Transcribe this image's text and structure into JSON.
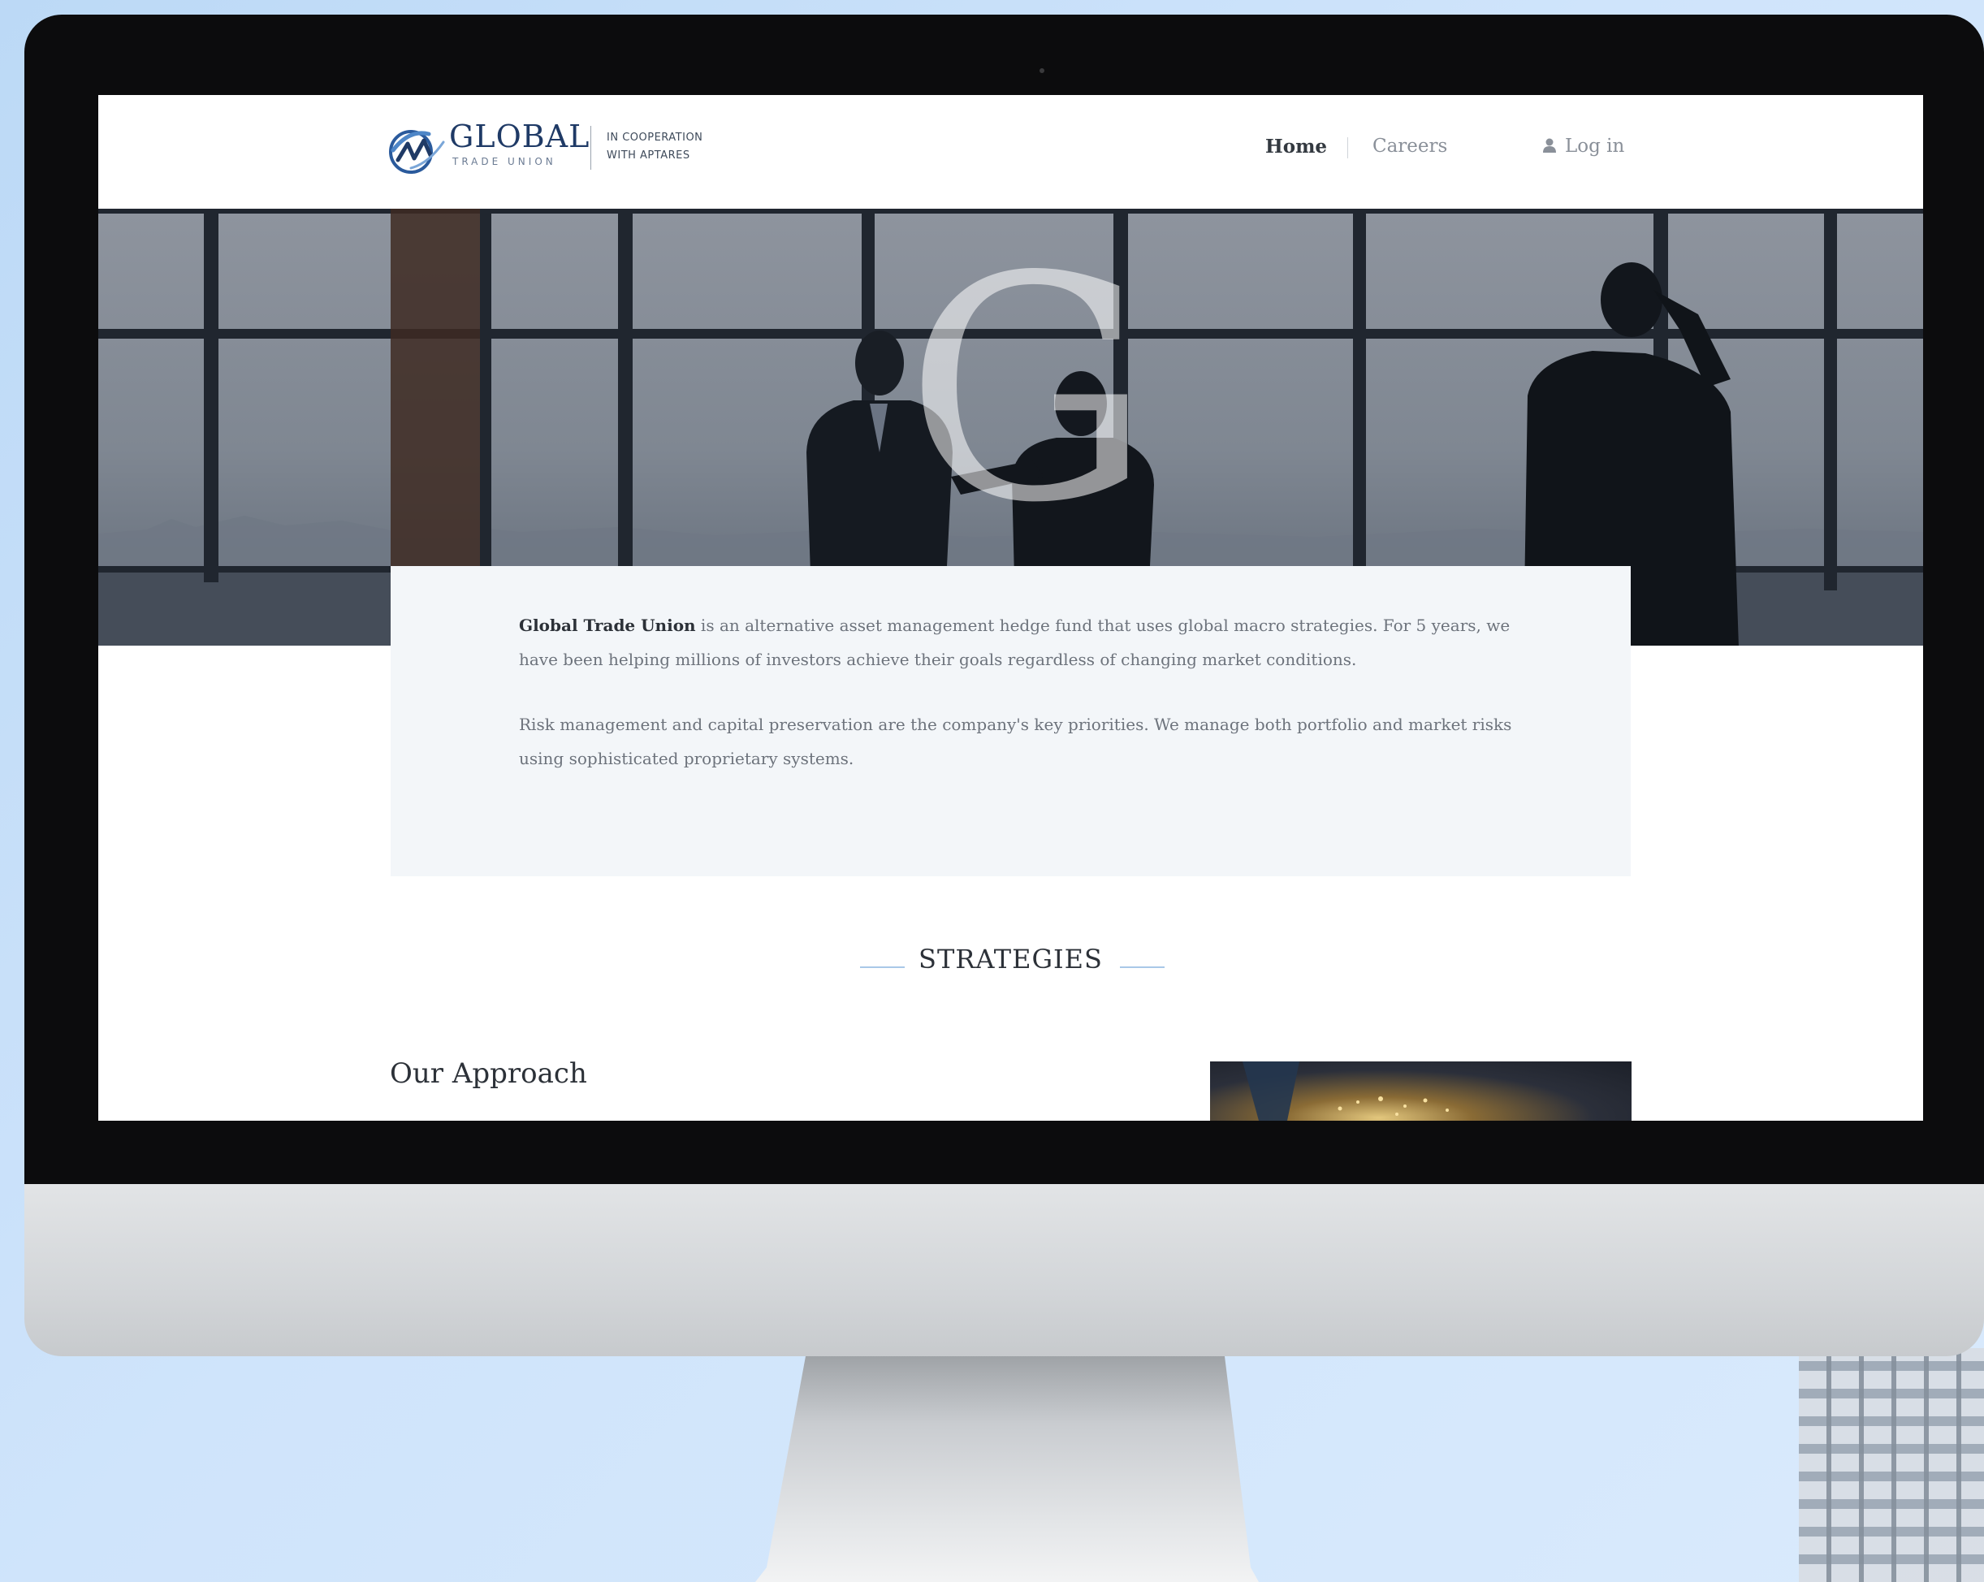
{
  "colors": {
    "page_background": "#cfe4fb",
    "brand": "#1f3a66",
    "accent_line": "#a9c8e8",
    "text_dark": "#2c3138",
    "text_muted": "#6d737c",
    "intro_box_bg": "#f3f6f9"
  },
  "header": {
    "logo_icon": "global-trade-union-logo-icon",
    "brand_name": "GLOBAL",
    "brand_subtitle": "TRADE UNION",
    "cooperation_line1": "IN COOPERATION",
    "cooperation_line2": "WITH APTARES",
    "nav": {
      "home": "Home",
      "careers": "Careers",
      "login": "Log in",
      "login_icon": "user-icon"
    }
  },
  "hero": {
    "image_icon": "business-people-silhouette-image",
    "watermark_letter": "G"
  },
  "intro": {
    "company_name": "Global Trade Union",
    "paragraph1_rest": " is an alternative asset management hedge fund that uses global macro strategies. For 5 years, we have been helping millions of investors achieve their goals regardless of changing market conditions.",
    "paragraph2": "Risk management and capital preservation are the company's key priorities. We manage both portfolio and market risks using sophisticated proprietary systems."
  },
  "strategies": {
    "section_title": "STRATEGIES",
    "approach_title": "Our Approach",
    "approach_image_icon": "glowing-globe-image"
  }
}
